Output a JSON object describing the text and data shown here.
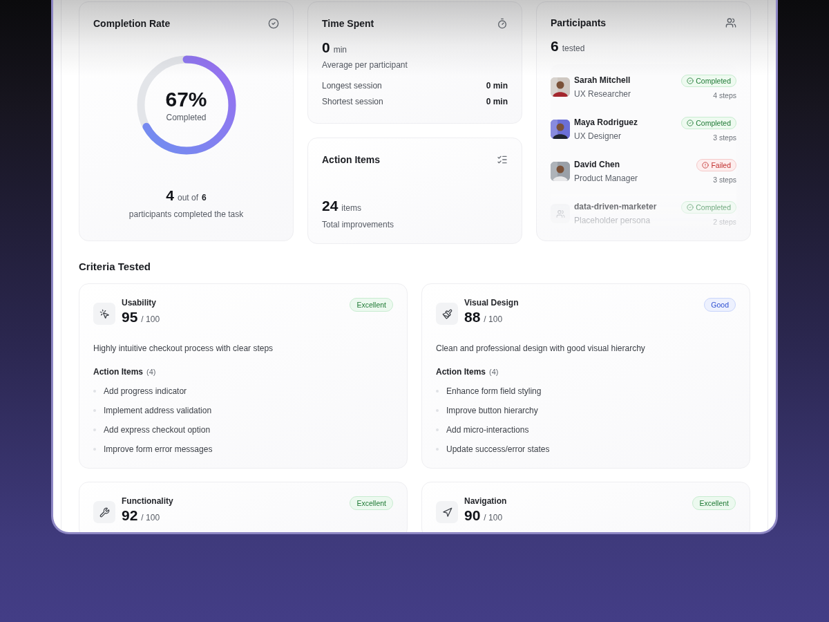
{
  "completion": {
    "title": "Completion Rate",
    "level": 0.67,
    "percent": "67%",
    "caption": "Completed",
    "count": "4",
    "out_of": "out of",
    "total": "6",
    "note": "participants completed the task"
  },
  "time_spent": {
    "title": "Time Spent",
    "value": "0",
    "unit": "min",
    "caption": "Average per participant",
    "rows": [
      {
        "label": "Longest session",
        "value": "0 min"
      },
      {
        "label": "Shortest session",
        "value": "0 min"
      }
    ]
  },
  "action_items": {
    "title": "Action Items",
    "value": "24",
    "unit": "items",
    "caption": "Total improvements"
  },
  "participants": {
    "title": "Participants",
    "value": "6",
    "unit": "tested",
    "people": [
      {
        "name": "Sarah Mitchell",
        "role": "UX Researcher",
        "failed": false,
        "status_label": "Completed",
        "steps": "4 steps"
      },
      {
        "name": "Maya Rodriguez",
        "role": "UX Designer",
        "failed": false,
        "status_label": "Completed",
        "steps": "3 steps"
      },
      {
        "name": "David Chen",
        "role": "Product Manager",
        "failed": true,
        "status_label": "Failed",
        "steps": "3 steps"
      },
      {
        "kind": "placeholder",
        "name": "data-driven-marketer",
        "role": "Placeholder persona",
        "failed": false,
        "status_label": "Completed",
        "steps": "2 steps"
      }
    ]
  },
  "criteria": {
    "title": "Criteria Tested",
    "items": [
      {
        "kind": "usability",
        "name": "Usability",
        "score": "95",
        "max": "/ 100",
        "color": "#ecf9ef",
        "rating_label": "Excellent",
        "description": "Highly intuitive checkout process with clear steps",
        "actions_title": "Action Items",
        "actions_count": "(4)",
        "actions": [
          "Add progress indicator",
          "Implement address validation",
          "Add express checkout option",
          "Improve form error messages"
        ]
      },
      {
        "kind": "visual",
        "name": "Visual Design",
        "score": "88",
        "max": "/ 100",
        "color": "#edf1fe",
        "rating_label": "Good",
        "description": "Clean and professional design with good visual hierarchy",
        "actions_title": "Action Items",
        "actions_count": "(4)",
        "actions": [
          "Enhance form field styling",
          "Improve button hierarchy",
          "Add micro-interactions",
          "Update success/error states"
        ]
      },
      {
        "kind": "functionality",
        "name": "Functionality",
        "score": "92",
        "max": "/ 100",
        "color": "#ecf9ef",
        "rating_label": "Excellent"
      },
      {
        "kind": "navigation",
        "name": "Navigation",
        "score": "90",
        "max": "/ 100",
        "color": "#ecf9ef",
        "rating_label": "Excellent"
      }
    ]
  }
}
